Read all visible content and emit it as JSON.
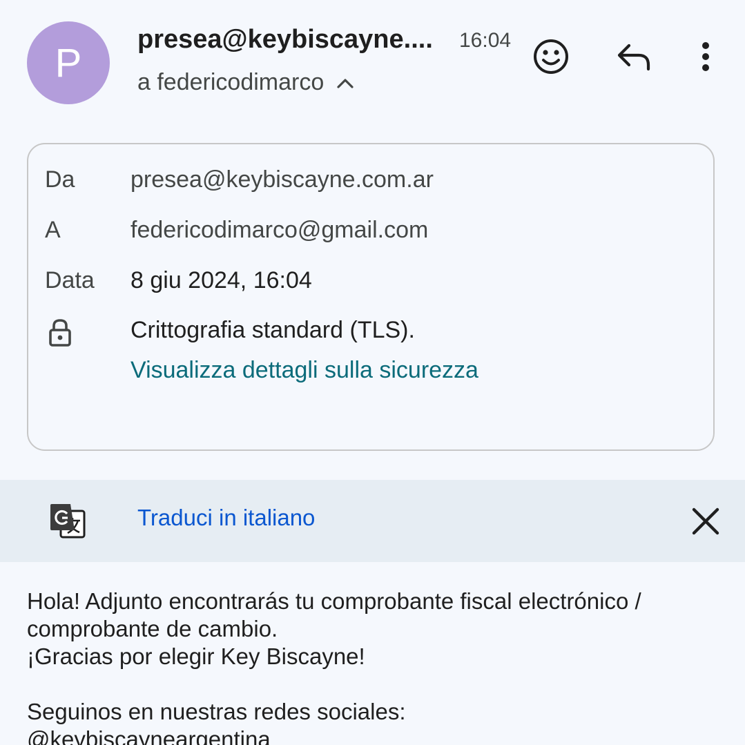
{
  "header": {
    "avatar_letter": "P",
    "avatar_color": "#b39ddb",
    "sender": "presea@keybiscayne....",
    "time": "16:04",
    "recipient": "a federicodimarco",
    "icons": [
      "emoji-icon",
      "reply-icon",
      "more-vert-icon",
      "chevron-up-icon"
    ]
  },
  "details": {
    "from_label": "Da",
    "from_value": "presea@keybiscayne.com.ar",
    "to_label": "A",
    "to_value": "federicodimarco@gmail.com",
    "date_label": "Data",
    "date_value": "8 giu 2024, 16:04",
    "encryption": "Crittografia standard (TLS).",
    "security_link": "Visualizza dettagli sulla sicurezza"
  },
  "translate": {
    "link": "Traduci in italiano",
    "icons": [
      "google-translate-icon",
      "close-icon"
    ]
  },
  "body": {
    "line1": "Hola! Adjunto encontrarás tu comprobante fiscal electrónico /",
    "line2": "comprobante de cambio.",
    "line3": "¡Gracias por elegir Key Biscayne!",
    "line4": "Seguinos en nuestras redes sociales:",
    "line5": "@keybiscayneargentina"
  },
  "colors": {
    "background": "#f5f8fd",
    "link_teal": "#0b6b7a",
    "link_blue": "#0b57d0",
    "translate_bar": "#e6edf3"
  }
}
